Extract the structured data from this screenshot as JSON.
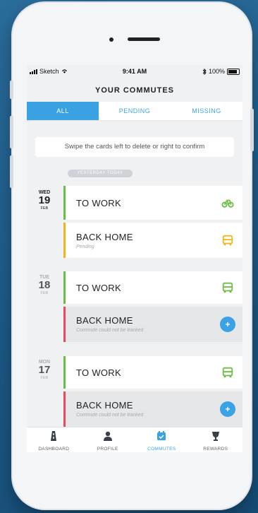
{
  "status_bar": {
    "carrier": "Sketch",
    "time": "9:41 AM",
    "battery": "100%"
  },
  "header": {
    "title": "YOUR COMMUTES"
  },
  "tabs": [
    {
      "label": "ALL"
    },
    {
      "label": "PENDING"
    },
    {
      "label": "MISSING"
    }
  ],
  "hint": {
    "text": "Swipe the cards left to delete or right to confirm"
  },
  "section_label": "YESTERDAY TODAY",
  "days": [
    {
      "dow": "WED",
      "day": "19",
      "mon": "FEB",
      "commutes": [
        {
          "name": "TO WORK",
          "sub": "",
          "icon": "bike-icon",
          "color": "#6bbd45",
          "action": "icon"
        },
        {
          "name": "BACK HOME",
          "sub": "Pending",
          "icon": "bus-icon",
          "color": "#f1b51c",
          "action": "icon"
        }
      ]
    },
    {
      "dow": "TUE",
      "day": "18",
      "mon": "FEB",
      "commutes": [
        {
          "name": "TO WORK",
          "sub": "",
          "icon": "bus-icon",
          "color": "#6bbd45",
          "action": "icon"
        },
        {
          "name": "BACK HOME",
          "sub": "Commute could not be tracked",
          "icon": "plus-icon",
          "color": "#e8495c",
          "action": "add"
        }
      ]
    },
    {
      "dow": "MON",
      "day": "17",
      "mon": "FEB",
      "commutes": [
        {
          "name": "TO WORK",
          "sub": "",
          "icon": "bus-icon",
          "color": "#6bbd45",
          "action": "icon"
        },
        {
          "name": "BACK HOME",
          "sub": "Commute could not be tracked",
          "icon": "plus-icon",
          "color": "#e8495c",
          "action": "add"
        }
      ]
    }
  ],
  "add_symbol": "+",
  "nav": [
    {
      "label": "DASHBOARD"
    },
    {
      "label": "PROFILE"
    },
    {
      "label": "COMMUTES"
    },
    {
      "label": "REWARDS"
    }
  ],
  "colors": {
    "accent": "#3aa1e3",
    "green": "#6bbd45",
    "yellow": "#f1b51c",
    "red": "#e8495c"
  }
}
